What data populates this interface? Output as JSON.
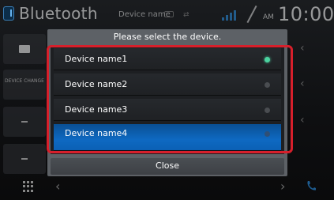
{
  "header": {
    "app_title": "Bluetooth",
    "device_name": "Device name",
    "band": "AM",
    "clock": "10:00"
  },
  "sidebar": {
    "device_change_label": "DEVICE CHANGE"
  },
  "dialog": {
    "title": "Please select the device.",
    "items": [
      {
        "label": "Device name1",
        "connected": true,
        "selected": false
      },
      {
        "label": "Device name2",
        "connected": false,
        "selected": false
      },
      {
        "label": "Device name3",
        "connected": false,
        "selected": false
      },
      {
        "label": "Device name4",
        "connected": false,
        "selected": true
      }
    ],
    "close_label": "Close"
  },
  "colors": {
    "accent": "#0e69c2",
    "connected": "#4bd3a0",
    "highlight": "#d71f2b"
  }
}
